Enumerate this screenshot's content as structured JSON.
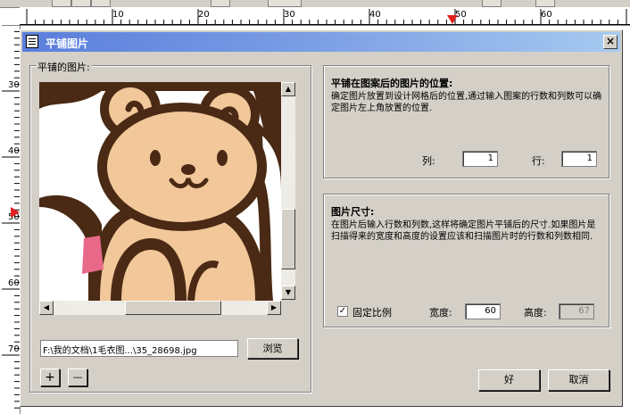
{
  "ruler": {
    "h_ticks": [
      "10",
      "20",
      "30",
      "40",
      "50",
      "60"
    ],
    "v_ticks": [
      "30",
      "40",
      "50",
      "60",
      "70"
    ]
  },
  "dialog": {
    "title": "平铺图片",
    "close_label": "×",
    "preview_group_label": "平铺的图片:",
    "file_path": "F:\\我的文档\\1毛衣图...\\35_28698.jpg",
    "browse_label": "浏览",
    "plus_label": "+",
    "minus_label": "—",
    "position_group": {
      "title": "平铺在图案后的图片的位置:",
      "description": "确定图片放置到设计网格后的位置,通过输入图案的行数和列数可以确定图片左上角放置的位置.",
      "col_label": "列:",
      "col_value": "1",
      "row_label": "行:",
      "row_value": "1"
    },
    "size_group": {
      "title": "图片尺寸:",
      "description": "在图片后输入行数和列数,这样将确定图片平铺后的尺寸.如果图片是扫描得来的宽度和高度的设置应该和扫描图片时的行数和列数相同.",
      "lock_ratio_label": "固定比例",
      "lock_ratio_checked": "✓",
      "width_label": "宽度:",
      "width_value": "60",
      "height_label": "高度:",
      "height_value": "67"
    },
    "ok_label": "好",
    "cancel_label": "取消"
  },
  "colors": {
    "title_start": "#5a7edc",
    "title_end": "#a6caf0",
    "bear_fill": "#f2c79a",
    "bear_outline": "#4a2a14",
    "pink": "#e8688a",
    "marker": "#e02020"
  }
}
